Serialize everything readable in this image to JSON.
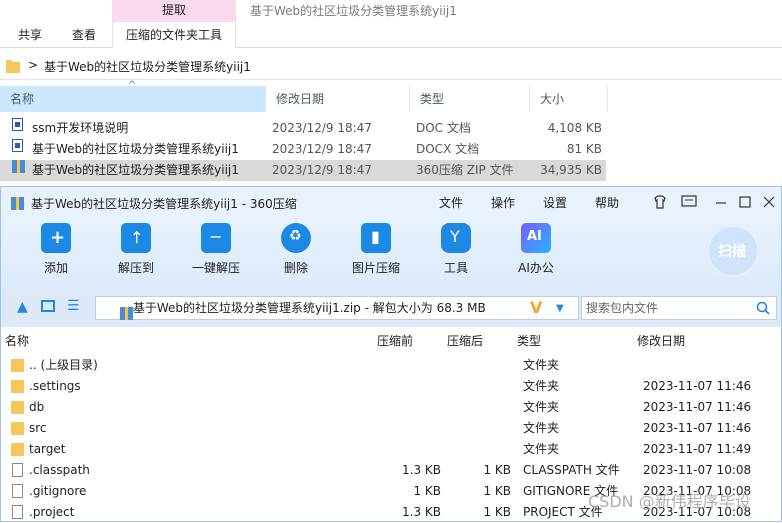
{
  "ribbon": {
    "context_tab": "提取",
    "window_title": "基于Web的社区垃圾分类管理系统yiij1",
    "tabs": [
      "共享",
      "查看",
      "压缩的文件夹工具"
    ]
  },
  "address_bar": {
    "separator": ">",
    "path": "基于Web的社区垃圾分类管理系统yiij1"
  },
  "explorer": {
    "columns": [
      "名称",
      "修改日期",
      "类型",
      "大小"
    ],
    "rows": [
      {
        "name": "ssm开发环境说明",
        "date": "2023/12/9 18:47",
        "type": "DOC 文档",
        "size": "4,108 KB"
      },
      {
        "name": "基于Web的社区垃圾分类管理系统yiij1",
        "date": "2023/12/9 18:47",
        "type": "DOCX 文档",
        "size": "81 KB"
      },
      {
        "name": "基于Web的社区垃圾分类管理系统yiij1",
        "date": "2023/12/9 18:47",
        "type": "360压缩 ZIP 文件",
        "size": "34,935 KB"
      }
    ]
  },
  "zipwin": {
    "title": "基于Web的社区垃圾分类管理系统yiij1 - 360压缩",
    "menu": [
      "文件",
      "操作",
      "设置",
      "帮助"
    ],
    "tools": [
      "添加",
      "解压到",
      "一键解压",
      "删除",
      "图片压缩",
      "工具",
      "AI办公"
    ],
    "scan_label": "扫描",
    "ai_badge": "AI",
    "path": "基于Web的社区垃圾分类管理系统yiij1.zip - 解包大小为 68.3 MB",
    "search_placeholder": "搜索包内文件",
    "columns": [
      "名称",
      "压缩前",
      "压缩后",
      "类型",
      "修改日期"
    ],
    "rows": [
      {
        "name": ".. (上级目录)",
        "before": "",
        "after": "",
        "type": "文件夹",
        "date": "",
        "kind": "folder"
      },
      {
        "name": ".settings",
        "before": "",
        "after": "",
        "type": "文件夹",
        "date": "2023-11-07 11:46",
        "kind": "folder"
      },
      {
        "name": "db",
        "before": "",
        "after": "",
        "type": "文件夹",
        "date": "2023-11-07 11:46",
        "kind": "folder"
      },
      {
        "name": "src",
        "before": "",
        "after": "",
        "type": "文件夹",
        "date": "2023-11-07 11:46",
        "kind": "folder"
      },
      {
        "name": "target",
        "before": "",
        "after": "",
        "type": "文件夹",
        "date": "2023-11-07 11:49",
        "kind": "folder"
      },
      {
        "name": ".classpath",
        "before": "1.3 KB",
        "after": "1 KB",
        "type": "CLASSPATH 文件",
        "date": "2023-11-07 10:08",
        "kind": "file"
      },
      {
        "name": ".gitignore",
        "before": "1 KB",
        "after": "1 KB",
        "type": "GITIGNORE 文件",
        "date": "2023-11-07 10:08",
        "kind": "file"
      },
      {
        "name": ".project",
        "before": "1.3 KB",
        "after": "1 KB",
        "type": "PROJECT 文件",
        "date": "2023-11-07 10:08",
        "kind": "file"
      }
    ]
  },
  "watermark": "CSDN @新伟程序毕设",
  "colors": {
    "accent": "#1e88e5",
    "tool_orange": "#f5a623",
    "selection": "#cce8ff"
  }
}
